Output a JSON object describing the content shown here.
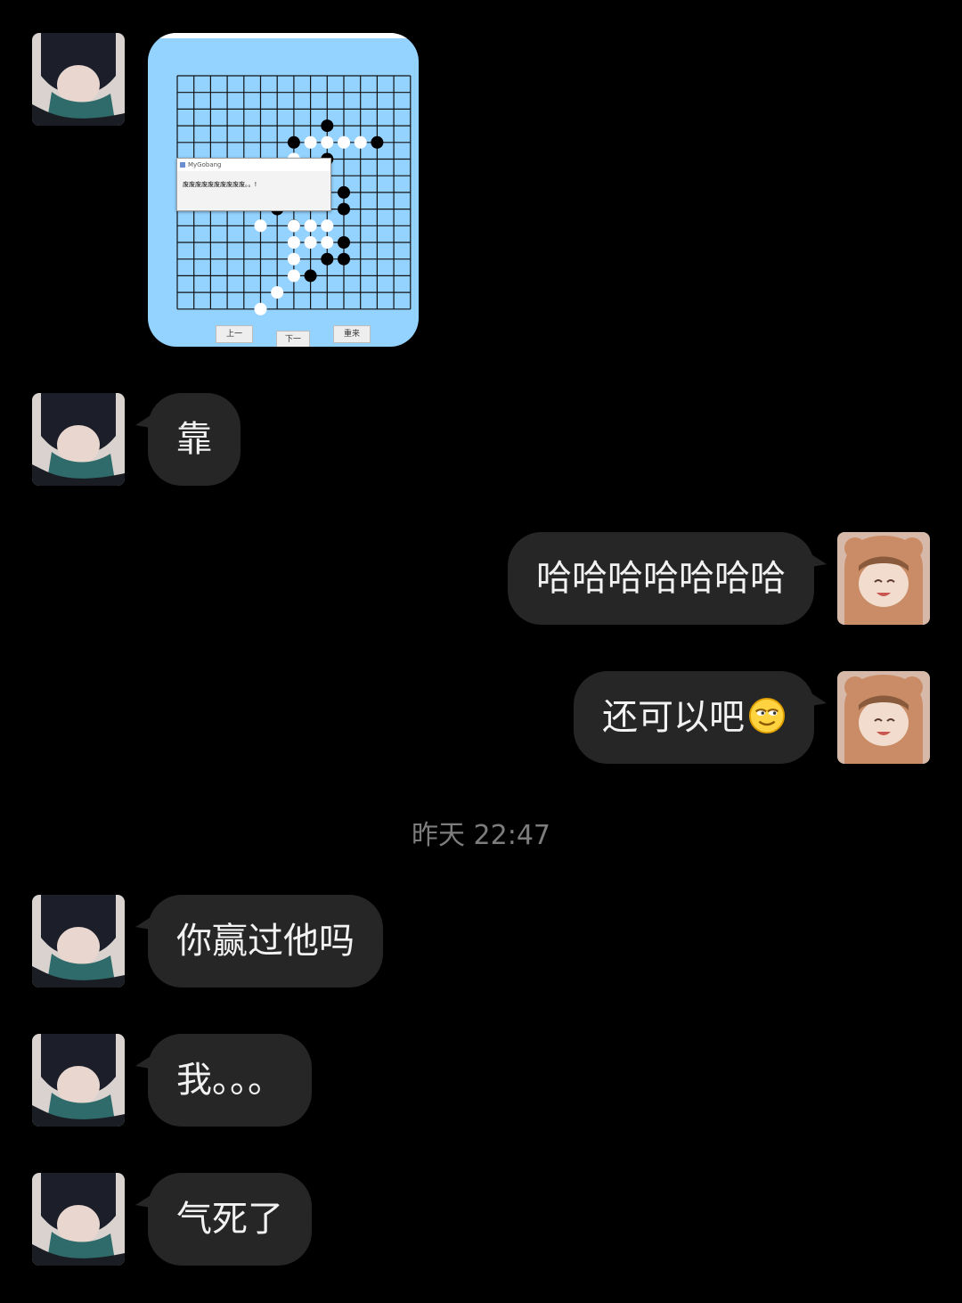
{
  "colors": {
    "background": "#000000",
    "bubble": "#262626",
    "bubble_text": "#f2f2f2",
    "timestamp": "#7d7d7d",
    "board_bg": "#94d3ff"
  },
  "image_message": {
    "dialog_title": "MyGobang",
    "dialog_text": "废废废废废废废废废废。。!",
    "buttons": [
      "上一",
      "下一",
      "重来"
    ]
  },
  "messages": [
    {
      "side": "left",
      "text": "靠"
    },
    {
      "side": "right",
      "text": "哈哈哈哈哈哈哈"
    },
    {
      "side": "right",
      "text": "还可以吧",
      "emoji": "smirk-emoji-icon"
    },
    {
      "side": "left",
      "text": "你赢过他吗"
    },
    {
      "side": "left",
      "text": "我。。。"
    },
    {
      "side": "left",
      "text": "气死了"
    }
  ],
  "timestamp": "昨天 22:47"
}
